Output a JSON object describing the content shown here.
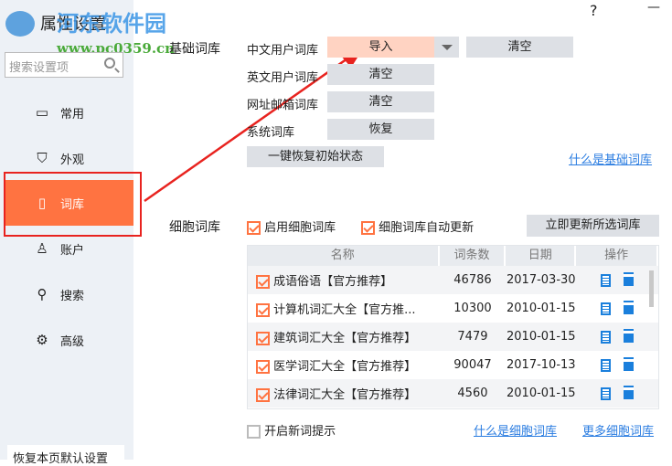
{
  "window": {
    "title": "属性设置",
    "help": "?",
    "minimize": "—"
  },
  "watermark": {
    "name": "河东软件园",
    "url": "www.pc0359.cn"
  },
  "sidebar": {
    "search_placeholder": "搜索设置项",
    "items": [
      {
        "icon": "monitor-icon",
        "label": "常用"
      },
      {
        "icon": "shirt-icon",
        "label": "外观"
      },
      {
        "icon": "book-icon",
        "label": "词库"
      },
      {
        "icon": "user-icon",
        "label": "账户"
      },
      {
        "icon": "search-icon",
        "label": "搜索"
      },
      {
        "icon": "gear-icon",
        "label": "高级"
      }
    ],
    "restore": "恢复本页默认设置"
  },
  "basic": {
    "title": "基础词库",
    "rows": [
      {
        "label": "中文用户词库",
        "btn1": "导入",
        "btn2": "清空"
      },
      {
        "label": "英文用户词库",
        "btn1": "清空"
      },
      {
        "label": "网址邮箱词库",
        "btn1": "清空"
      },
      {
        "label": "系统词库",
        "btn1": "恢复"
      }
    ],
    "reset": "一键恢复初始状态",
    "help_link": "什么是基础词库"
  },
  "cell": {
    "title": "细胞词库",
    "enable": "启用细胞词库",
    "auto_update": "细胞词库自动更新",
    "update_btn": "立即更新所选词库",
    "columns": [
      "名称",
      "词条数",
      "日期",
      "操作"
    ],
    "rows": [
      {
        "name": "成语俗语【官方推荐】",
        "count": "46786",
        "date": "2017-03-30"
      },
      {
        "name": "计算机词汇大全【官方推...",
        "count": "10300",
        "date": "2010-01-15"
      },
      {
        "name": "建筑词汇大全【官方推荐】",
        "count": "7479",
        "date": "2010-01-15"
      },
      {
        "name": "医学词汇大全【官方推荐】",
        "count": "90047",
        "date": "2017-10-13"
      },
      {
        "name": "法律词汇大全【官方推荐】",
        "count": "4560",
        "date": "2010-01-15"
      }
    ],
    "new_word_tip": "开启新词提示",
    "what_link": "什么是细胞词库",
    "more_link": "更多细胞词库"
  }
}
